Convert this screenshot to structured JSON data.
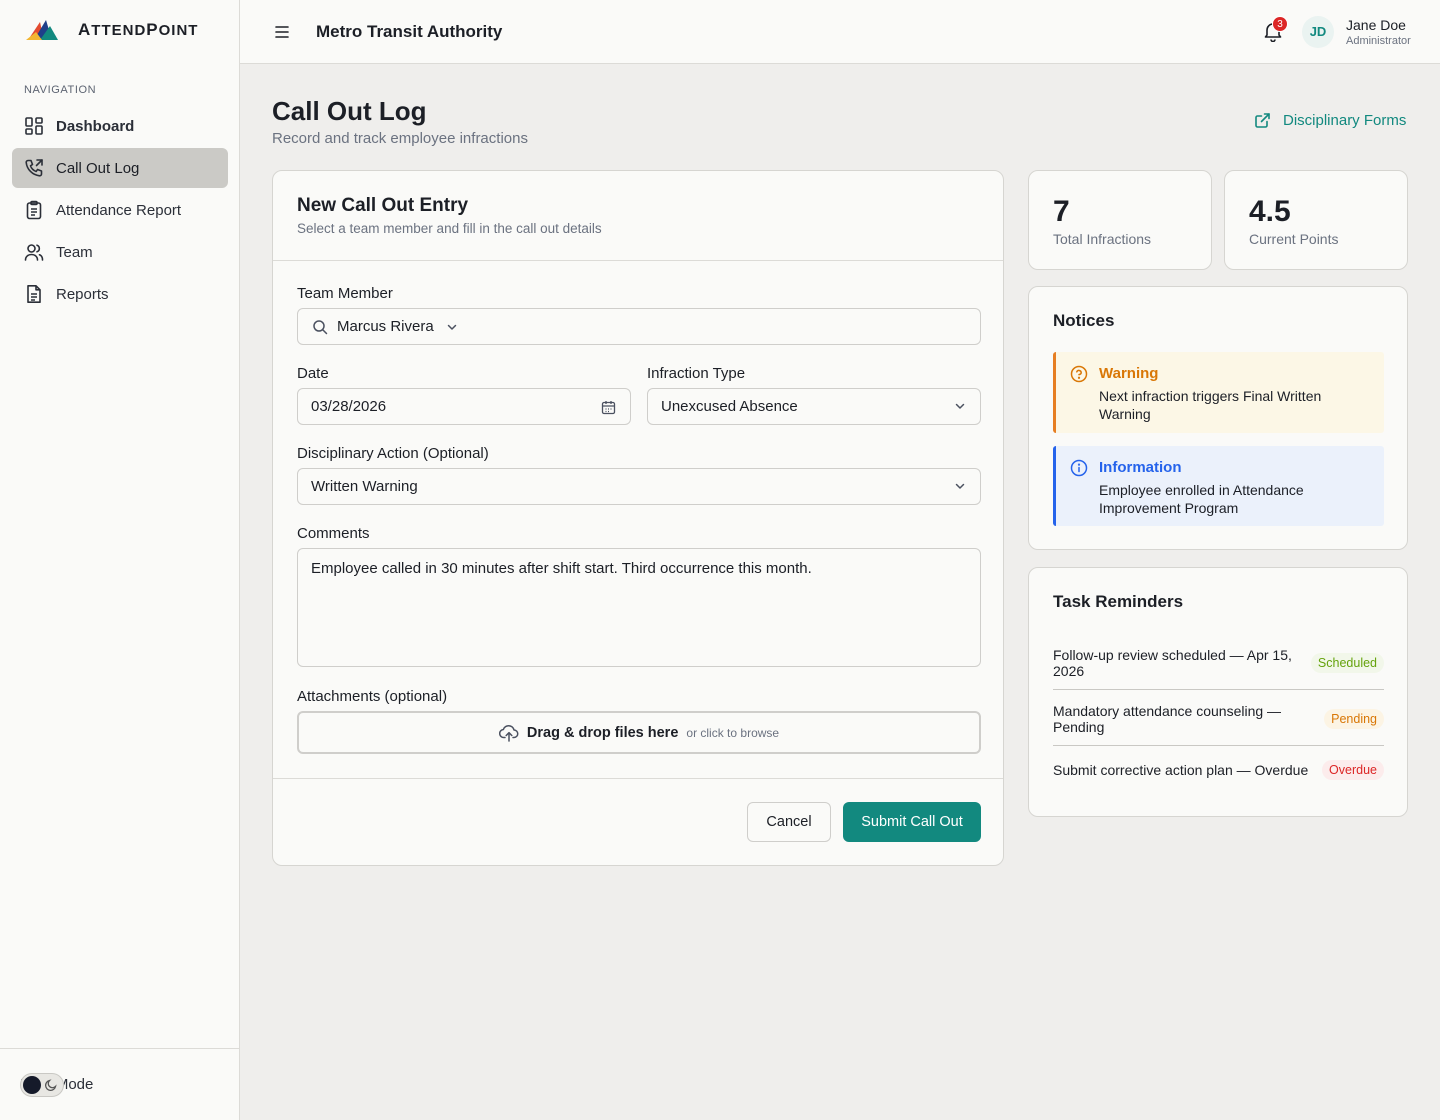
{
  "brand": {
    "name_first": "A",
    "name_rest": "TTEND",
    "name_first2": "P",
    "name_rest2": "OINT"
  },
  "sidebar": {
    "caption": "NAVIGATION",
    "items": [
      {
        "label": "Dashboard",
        "icon": "dashboard-icon"
      },
      {
        "label": "Call Out Log",
        "icon": "phone-icon",
        "active": true
      },
      {
        "label": "Attendance Report",
        "icon": "clipboard-icon"
      },
      {
        "label": "Team",
        "icon": "users-icon"
      },
      {
        "label": "Reports",
        "icon": "document-icon"
      }
    ],
    "dark_mode_label": "Dark Mode"
  },
  "header": {
    "org": "Metro Transit Authority",
    "notifications": "3",
    "avatar": "JD",
    "user_name": "Jane Doe",
    "user_role": "Administrator"
  },
  "page": {
    "title": "Call Out Log",
    "subtitle": "Record and track employee infractions",
    "forms_link": "Disciplinary Forms"
  },
  "form": {
    "title": "New Call Out Entry",
    "subtitle": "Select a team member and fill in the call out details",
    "team_member_label": "Team Member",
    "team_member_value": "Marcus Rivera",
    "date_label": "Date",
    "date_value": "03/28/2026",
    "infraction_label": "Infraction Type",
    "infraction_value": "Unexcused Absence",
    "action_label": "Disciplinary Action (Optional)",
    "action_value": "Written Warning",
    "comments_label": "Comments",
    "comments_value": "Employee called in 30 minutes after shift start. Third occurrence this month.",
    "attachments_label": "Attachments (optional)",
    "dropzone_main": "Drag & drop files here",
    "dropzone_sub": "or click to browse",
    "cancel": "Cancel",
    "submit": "Submit Call Out"
  },
  "stats": [
    {
      "value": "7",
      "label": "Total Infractions"
    },
    {
      "value": "4.5",
      "label": "Current Points"
    }
  ],
  "notices": {
    "title": "Notices",
    "items": [
      {
        "title": "Warning",
        "text": "Next infraction triggers Final Written Warning"
      },
      {
        "title": "Information",
        "text": "Employee enrolled in Attendance Improvement Program"
      }
    ]
  },
  "tasks": {
    "title": "Task Reminders",
    "items": [
      {
        "text": "Follow-up review scheduled — Apr 15, 2026",
        "status": "Scheduled"
      },
      {
        "text": "Mandatory attendance counseling — Pending",
        "status": "Pending"
      },
      {
        "text": "Submit corrective action plan — Overdue",
        "status": "Overdue"
      }
    ]
  },
  "colors": {
    "accent": "#12897f",
    "warning": "#d97706",
    "info": "#2563eb",
    "danger": "#dc2626"
  }
}
